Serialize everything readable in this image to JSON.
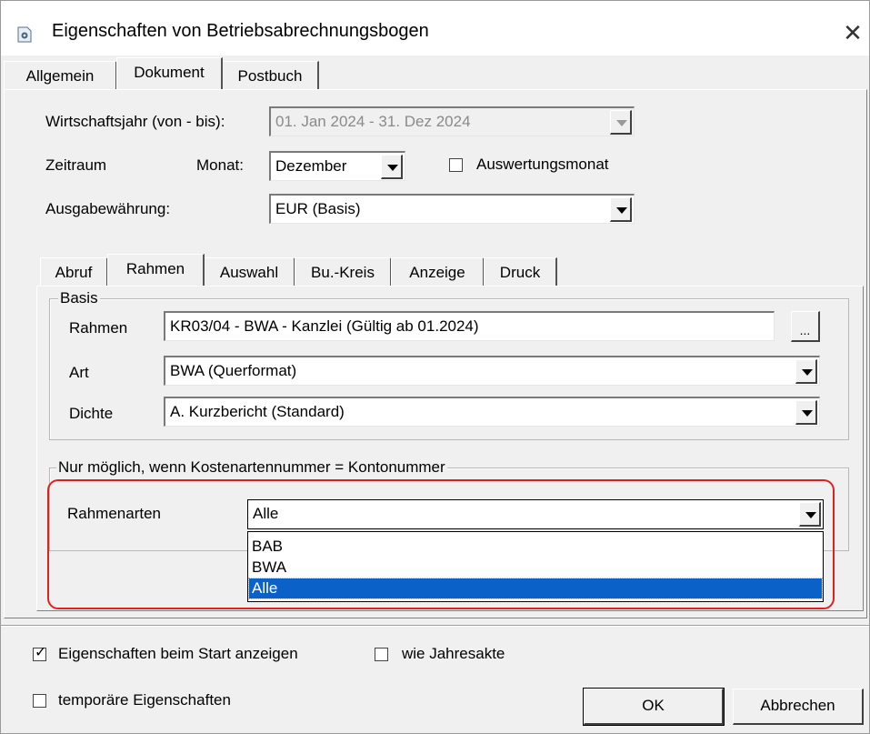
{
  "window": {
    "title": "Eigenschaften von Betriebsabrechnungsbogen",
    "close_glyph": "✕",
    "icon": "document-gear-icon"
  },
  "main_tabs": [
    "Allgemein",
    "Dokument",
    "Postbuch"
  ],
  "main_tab_selected": "Dokument",
  "dokument": {
    "wj_label": "Wirtschaftsjahr (von - bis):",
    "wj_value": "01. Jan 2024  -  31. Dez 2024",
    "zeitraum_label": "Zeitraum",
    "monat_label": "Monat:",
    "monat_value": "Dezember",
    "auswertungsmonat_label": "Auswertungsmonat",
    "auswertungsmonat_checked": false,
    "waehrung_label": "Ausgabewährung:",
    "waehrung_value": "EUR (Basis)"
  },
  "sub_tabs": [
    "Abruf",
    "Rahmen",
    "Auswahl",
    "Bu.-Kreis",
    "Anzeige",
    "Druck"
  ],
  "sub_tab_selected": "Rahmen",
  "basis": {
    "title": "Basis",
    "rahmen_label": "Rahmen",
    "rahmen_value": "KR03/04 - BWA - Kanzlei (Gültig ab 01.2024)",
    "ellipsis": "...",
    "art_label": "Art",
    "art_value": "BWA (Querformat)",
    "dichte_label": "Dichte",
    "dichte_value": "A.  Kurzbericht (Standard)"
  },
  "kostenarten": {
    "title": "Nur möglich, wenn Kostenartennummer = Kontonummer",
    "rahmenarten_label": "Rahmenarten",
    "rahmenarten_value": "Alle",
    "options": [
      "BAB",
      "BWA",
      "Alle"
    ],
    "selected_option": "Alle"
  },
  "footer": {
    "start_label": "Eigenschaften beim Start anzeigen",
    "start_checked": true,
    "jahresakte_label": "wie Jahresakte",
    "jahresakte_checked": false,
    "temp_label": "temporäre Eigenschaften",
    "temp_checked": false,
    "ok_label": "OK",
    "cancel_label": "Abbrechen",
    "check_glyph": "✓"
  },
  "colors": {
    "highlight": "#e0201e",
    "selection": "#0a62c8"
  }
}
